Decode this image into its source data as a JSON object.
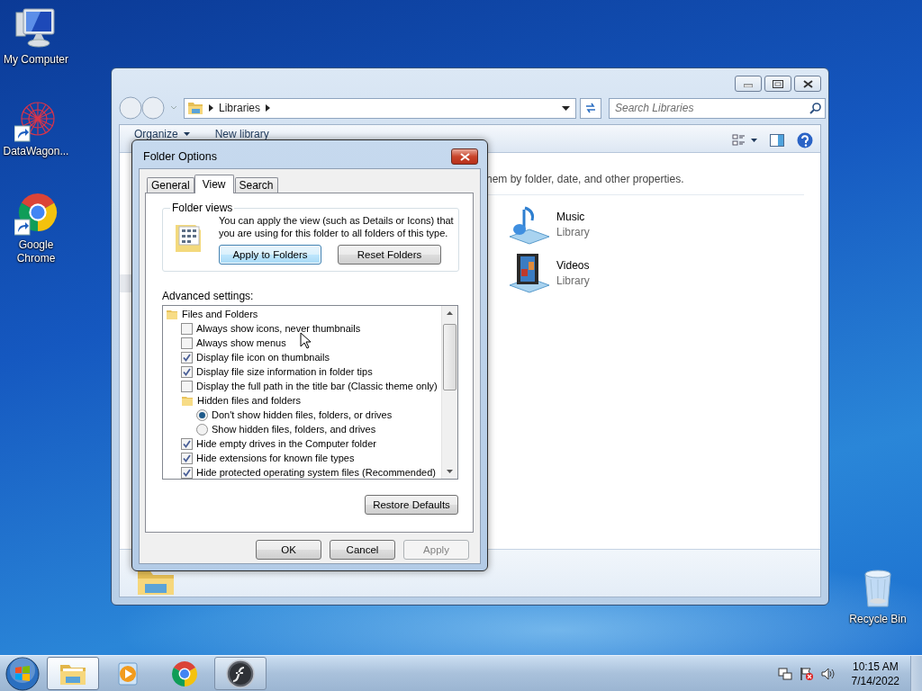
{
  "desktop_icons": [
    {
      "label": "My Computer",
      "kind": "computer"
    },
    {
      "label": "DataWagon...",
      "kind": "network-shortcut"
    },
    {
      "label": "Google Chrome",
      "kind": "chrome-shortcut"
    }
  ],
  "recycle_bin": {
    "label": "Recycle Bin"
  },
  "explorer": {
    "breadcrumb": [
      "Libraries"
    ],
    "search": {
      "placeholder": "Search Libraries"
    },
    "toolbar": [
      "Organize",
      "New library"
    ],
    "description": "hem by folder, date, and other properties.",
    "libraries": [
      {
        "name": "Music",
        "type": "Library",
        "kind": "music"
      },
      {
        "name": "Videos",
        "type": "Library",
        "kind": "videos"
      }
    ]
  },
  "dialog": {
    "title": "Folder Options",
    "tabs": [
      {
        "label": "General",
        "selected": false
      },
      {
        "label": "View",
        "selected": true
      },
      {
        "label": "Search",
        "selected": false
      }
    ],
    "folder_views": {
      "title": "Folder views",
      "text": "You can apply the view (such as Details or Icons) that you are using for this folder to all folders of this type.",
      "buttons": [
        {
          "label": "Apply to Folders",
          "focused": true
        },
        {
          "label": "Reset Folders",
          "focused": false
        }
      ]
    },
    "advanced_label": "Advanced settings:",
    "settings": [
      {
        "kind": "folder",
        "label": "Files and Folders",
        "children": [
          {
            "kind": "checkbox",
            "label": "Always show icons, never thumbnails",
            "checked": false
          },
          {
            "kind": "checkbox",
            "label": "Always show menus",
            "checked": false
          },
          {
            "kind": "checkbox",
            "label": "Display file icon on thumbnails",
            "checked": true
          },
          {
            "kind": "checkbox",
            "label": "Display file size information in folder tips",
            "checked": true
          },
          {
            "kind": "checkbox",
            "label": "Display the full path in the title bar (Classic theme only)",
            "checked": false
          },
          {
            "kind": "folder",
            "label": "Hidden files and folders",
            "children": [
              {
                "kind": "radio",
                "label": "Don't show hidden files, folders, or drives",
                "selected": true
              },
              {
                "kind": "radio",
                "label": "Show hidden files, folders, and drives",
                "selected": false
              }
            ]
          },
          {
            "kind": "checkbox",
            "label": "Hide empty drives in the Computer folder",
            "checked": true
          },
          {
            "kind": "checkbox",
            "label": "Hide extensions for known file types",
            "checked": true
          },
          {
            "kind": "checkbox",
            "label": "Hide protected operating system files (Recommended)",
            "checked": true
          }
        ]
      }
    ],
    "restore_button": "Restore Defaults",
    "buttons": [
      {
        "label": "OK",
        "disabled": false
      },
      {
        "label": "Cancel",
        "disabled": false
      },
      {
        "label": "Apply",
        "disabled": true
      }
    ]
  },
  "taskbar": {
    "apps": [
      {
        "kind": "explorer",
        "open": true,
        "active": true
      },
      {
        "kind": "media-player",
        "open": false,
        "active": false
      },
      {
        "kind": "chrome",
        "open": false,
        "active": false
      },
      {
        "kind": "flash",
        "open": true,
        "active": false
      }
    ],
    "time": "10:15 AM",
    "date": "7/14/2022"
  }
}
